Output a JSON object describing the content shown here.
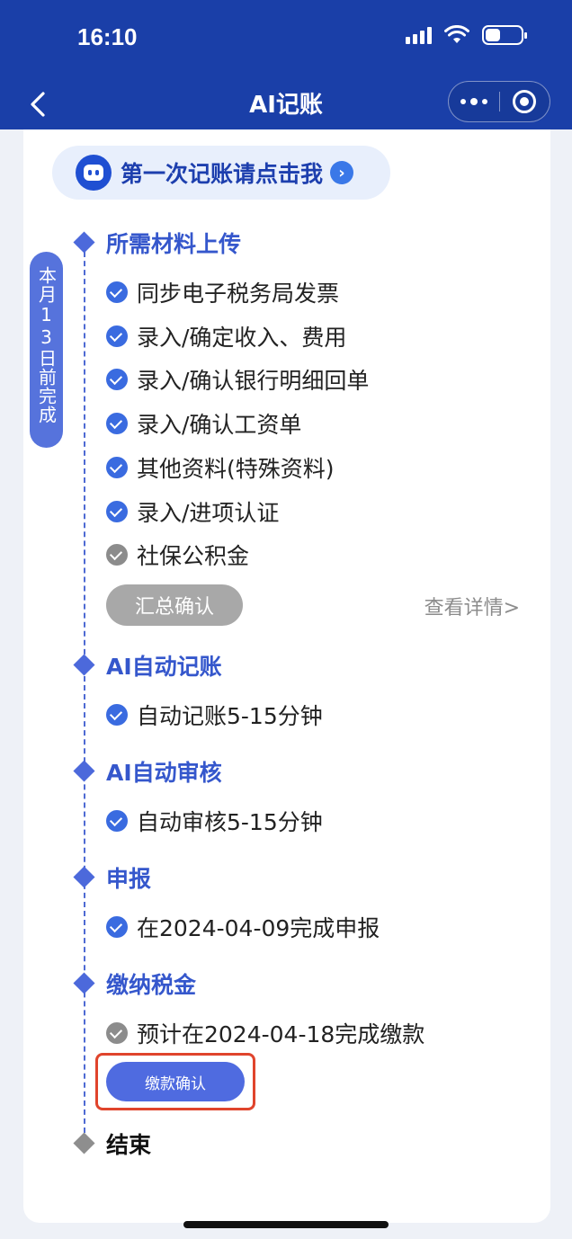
{
  "status_bar": {
    "time": "16:10"
  },
  "navbar": {
    "title": "AI记账",
    "back_icon": "chevron-left-icon"
  },
  "guide": {
    "text": "第一次记账请点击我"
  },
  "deadline_badge": "本月13日前完成",
  "sections": {
    "materials": {
      "title": "所需材料上传",
      "items": [
        {
          "label": "同步电子税务局发票",
          "status": "done"
        },
        {
          "label": "录入/确定收入、费用",
          "status": "done"
        },
        {
          "label": "录入/确认银行明细回单",
          "status": "done"
        },
        {
          "label": "录入/确认工资单",
          "status": "done"
        },
        {
          "label": "其他资料(特殊资料)",
          "status": "done"
        },
        {
          "label": "录入/进项认证",
          "status": "done"
        },
        {
          "label": "社保公积金",
          "status": "pending"
        }
      ],
      "summary_button": "汇总确认",
      "details_link": "查看详情>"
    },
    "auto_bookkeeping": {
      "title": "AI自动记账",
      "item": "自动记账5-15分钟"
    },
    "auto_review": {
      "title": "AI自动审核",
      "item": "自动审核5-15分钟"
    },
    "declare": {
      "title": "申报",
      "item": "在2024-04-09完成申报"
    },
    "pay_tax": {
      "title": "缴纳税金",
      "item": "预计在2024-04-18完成缴款",
      "button": "缴款确认"
    },
    "end": {
      "title": "结束"
    }
  },
  "colors": {
    "primary": "#1a3fa8",
    "accent": "#4c69db",
    "highlight": "#e0442c",
    "muted": "#8c8c8c"
  }
}
